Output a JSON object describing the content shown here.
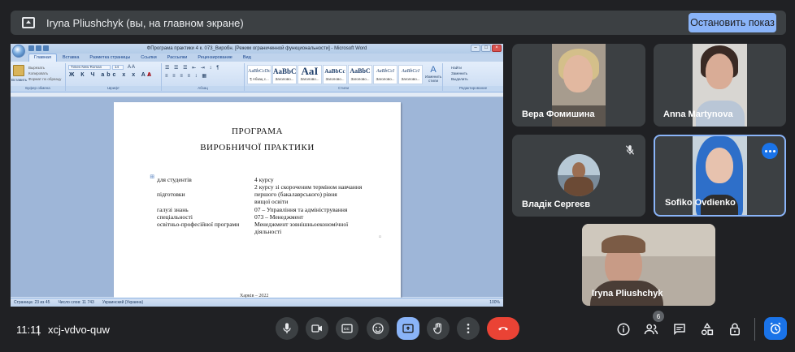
{
  "banner": {
    "title": "Iryna Pliushchyk (вы, на главном экране)",
    "stop_label": "Остановить показ",
    "icon": "present-to-all-icon"
  },
  "word": {
    "window_title": "ФПрограма практики 4 к. 073_Виробн. [Режим ограниченной функциональности] - Microsoft Word",
    "tabs": [
      "Главная",
      "Вставка",
      "Разметка страницы",
      "Ссылки",
      "Рассылки",
      "Рецензирование",
      "Вид"
    ],
    "ribbon": {
      "paste_label": "Вставить",
      "clipboard_items": [
        "Вырезать",
        "Копировать",
        "Формат по образцу"
      ],
      "font_name": "Times New Roman",
      "font_size": "14",
      "groups": [
        "Буфер обмена",
        "Шрифт",
        "Абзац",
        "Стили",
        "Редактирование"
      ],
      "styles": [
        {
          "sample": "AaBbCcDc",
          "name": "¶ Абзац с..."
        },
        {
          "sample": "AaBbC",
          "name": "Заголово..."
        },
        {
          "sample": "AaI",
          "name": "Заголово..."
        },
        {
          "sample": "AaBbCc",
          "name": "Заголово..."
        },
        {
          "sample": "AaBbC",
          "name": "Заголово..."
        },
        {
          "sample": "AaBbCcI",
          "name": "Заголово..."
        },
        {
          "sample": "AaBbCcI",
          "name": "Заголово..."
        }
      ],
      "change_styles": "Изменить стили",
      "edit_items": [
        "Найти",
        "Заменить",
        "Выделить"
      ]
    },
    "document": {
      "heading1": "ПРОГРАМА",
      "heading2": "ВИРОБНИЧОЇ ПРАКТИКИ",
      "rows": [
        {
          "label": "для студентів",
          "value": "4 курсу"
        },
        {
          "label": "",
          "value": "2 курсу зі скороченим терміном навчання"
        },
        {
          "label": "підготовки",
          "value": "першого (бакалаврського) рівня"
        },
        {
          "label": "",
          "value": "вищої освіти"
        },
        {
          "label": "галузі знань",
          "value": "07 –  Управління та адміністрування"
        },
        {
          "label": "спеціальності",
          "value": "073 – Менеджмент"
        },
        {
          "label": "освітньо-професійної програми",
          "value": "Менеджмент зовнішньоекономічної"
        },
        {
          "label": "",
          "value": "діяльності"
        }
      ],
      "footer_text": "Харків – 2022"
    },
    "status": {
      "page": "Страница: 23 из 45",
      "words": "Число слов: 11 743",
      "language": "Украинский (Украина)",
      "zoom": "100%"
    }
  },
  "participants": [
    {
      "name": "Вера Фомишина",
      "muted": false
    },
    {
      "name": "Anna Martynova",
      "muted": false
    },
    {
      "name": "Владік Сергеєв",
      "muted": true
    },
    {
      "name": "Sofiko Ovdienko",
      "muted": false,
      "speaking": true
    },
    {
      "name": "Iryna Pliushchyk",
      "muted": false
    }
  ],
  "bottom_bar": {
    "time": "11:11",
    "separator": "|",
    "meeting_code": "xcj-vdvo-quw",
    "people_count": "6",
    "controls": [
      "mic-icon",
      "camera-icon",
      "captions-icon",
      "emoji-icon",
      "present-icon",
      "raise-hand-icon",
      "more-vert-icon",
      "end-call-icon"
    ],
    "right_controls": [
      "info-icon",
      "people-icon",
      "chat-icon",
      "activities-icon",
      "host-controls-icon",
      "timer-icon"
    ]
  },
  "colors": {
    "background": "#202124",
    "tile": "#3c4043",
    "accent": "#8ab4f8",
    "end_call": "#ea4335",
    "highlight": "#1a73e8"
  }
}
